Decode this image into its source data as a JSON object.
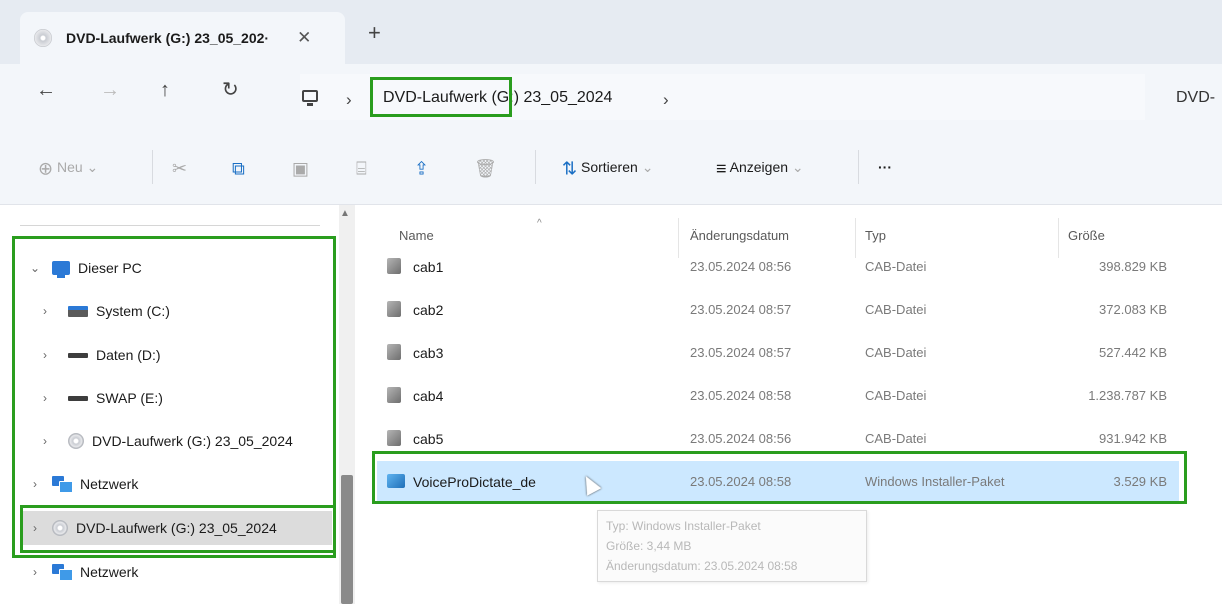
{
  "tab": {
    "title": "DVD-Laufwerk (G:) 23_05_202·",
    "close": "✕",
    "new": "+"
  },
  "nav": {
    "back": "←",
    "forward": "→",
    "up": "↑",
    "refresh": "↻"
  },
  "address": {
    "sep1": "›",
    "crumb": "DVD-Laufwerk (G:) 23_05_2024",
    "sep2": "›",
    "right_text": "DVD-"
  },
  "toolbar": {
    "new_label": "Neu",
    "sort_label": "Sortieren",
    "view_label": "Anzeigen",
    "more_label": "···",
    "icons": [
      "plus-circle",
      "cut",
      "copy",
      "paste",
      "rename",
      "share",
      "delete",
      "sort-arrows",
      "view-lines",
      "more"
    ]
  },
  "sidebar": {
    "items": [
      {
        "label": "Dieser PC",
        "chev": "⌄",
        "icon": "pc"
      },
      {
        "label": "System (C:)",
        "chev": "›",
        "icon": "drive-system"
      },
      {
        "label": "Daten (D:)",
        "chev": "›",
        "icon": "drive"
      },
      {
        "label": "SWAP (E:)",
        "chev": "›",
        "icon": "drive"
      },
      {
        "label": "DVD-Laufwerk (G:) 23_05_2024",
        "chev": "›",
        "icon": "dvd"
      },
      {
        "label": "Netzwerk",
        "chev": "›",
        "icon": "network"
      },
      {
        "label": "DVD-Laufwerk (G:) 23_05_2024",
        "chev": "›",
        "icon": "dvd",
        "selected": true
      },
      {
        "label": "Netzwerk",
        "chev": "›",
        "icon": "network"
      }
    ]
  },
  "filelist": {
    "columns": {
      "name": "Name",
      "date": "Änderungsdatum",
      "type": "Typ",
      "size": "Größe"
    },
    "rows": [
      {
        "name": "cab1",
        "date": "23.05.2024 08:56",
        "type": "CAB-Datei",
        "size": "398.829 KB"
      },
      {
        "name": "cab2",
        "date": "23.05.2024 08:57",
        "type": "CAB-Datei",
        "size": "372.083 KB"
      },
      {
        "name": "cab3",
        "date": "23.05.2024 08:57",
        "type": "CAB-Datei",
        "size": "527.442 KB"
      },
      {
        "name": "cab4",
        "date": "23.05.2024 08:58",
        "type": "CAB-Datei",
        "size": "1.238.787 KB"
      },
      {
        "name": "cab5",
        "date": "23.05.2024 08:56",
        "type": "CAB-Datei",
        "size": "931.942 KB"
      },
      {
        "name": "VoiceProDictate_de",
        "date": "23.05.2024 08:58",
        "type": "Windows Installer-Paket",
        "size": "3.529 KB",
        "selected": true
      }
    ]
  },
  "tooltip": {
    "line1": "Typ: Windows Installer-Paket",
    "line2": "Größe: 3,44 MB",
    "line3": "Änderungsdatum: 23.05.2024 08:58"
  },
  "colors": {
    "highlight_box": "#2a9d1e",
    "selection": "#cce8ff",
    "accent": "#2b79d6"
  }
}
